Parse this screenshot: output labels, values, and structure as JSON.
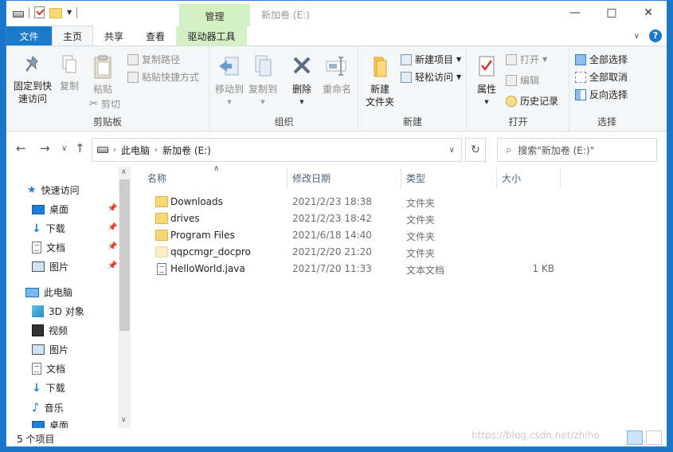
{
  "window": {
    "title": "新加卷 (E:)",
    "context_tab": "管理"
  },
  "tabs": [
    {
      "label": "文件"
    },
    {
      "label": "主页"
    },
    {
      "label": "共享"
    },
    {
      "label": "查看"
    },
    {
      "label": "驱动器工具"
    }
  ],
  "ribbon": {
    "clipboard": {
      "label": "剪贴板",
      "pin_quick": "固定到快\n速访问",
      "copy": "复制",
      "paste": "粘贴",
      "copy_path": "复制路径",
      "paste_shortcut": "粘贴快捷方式",
      "cut": "剪切"
    },
    "organize": {
      "label": "组织",
      "move_to": "移动到",
      "copy_to": "复制到",
      "delete": "删除",
      "rename": "重命名"
    },
    "new": {
      "label": "新建",
      "new_folder": "新建\n文件夹",
      "new_item": "新建项目",
      "easy_access": "轻松访问"
    },
    "open": {
      "label": "打开",
      "properties": "属性",
      "open": "打开",
      "edit": "编辑",
      "history": "历史记录"
    },
    "select": {
      "label": "选择",
      "select_all": "全部选择",
      "select_none": "全部取消",
      "invert": "反向选择"
    }
  },
  "navbar": {
    "path": [
      "此电脑",
      "新加卷 (E:)"
    ],
    "search_placeholder": "搜索\"新加卷 (E:)\""
  },
  "nav_pane": {
    "quick_access": "快速访问",
    "quick_items": [
      "桌面",
      "下载",
      "文档",
      "图片"
    ],
    "this_pc": "此电脑",
    "pc_items": [
      "3D 对象",
      "视频",
      "图片",
      "文档",
      "下载",
      "音乐",
      "桌面"
    ]
  },
  "columns": {
    "name": "名称",
    "date": "修改日期",
    "type": "类型",
    "size": "大小"
  },
  "files": [
    {
      "name": "Downloads",
      "date": "2021/2/23 18:38",
      "type": "文件夹",
      "size": "",
      "icon": "folder-icon"
    },
    {
      "name": "drives",
      "date": "2021/2/23 18:42",
      "type": "文件夹",
      "size": "",
      "icon": "folder-icon"
    },
    {
      "name": "Program Files",
      "date": "2021/6/18 14:40",
      "type": "文件夹",
      "size": "",
      "icon": "folder-icon"
    },
    {
      "name": "qqpcmgr_docpro",
      "date": "2021/2/20 21:20",
      "type": "文件夹",
      "size": "",
      "icon": "hidden-folder-icon"
    },
    {
      "name": "HelloWorld.java",
      "date": "2021/7/20 11:33",
      "type": "文本文档",
      "size": "1 KB",
      "icon": "text-file-icon"
    }
  ],
  "status": {
    "count": "5 个项目"
  },
  "watermark": "https://blog.csdn.net/zhiho"
}
